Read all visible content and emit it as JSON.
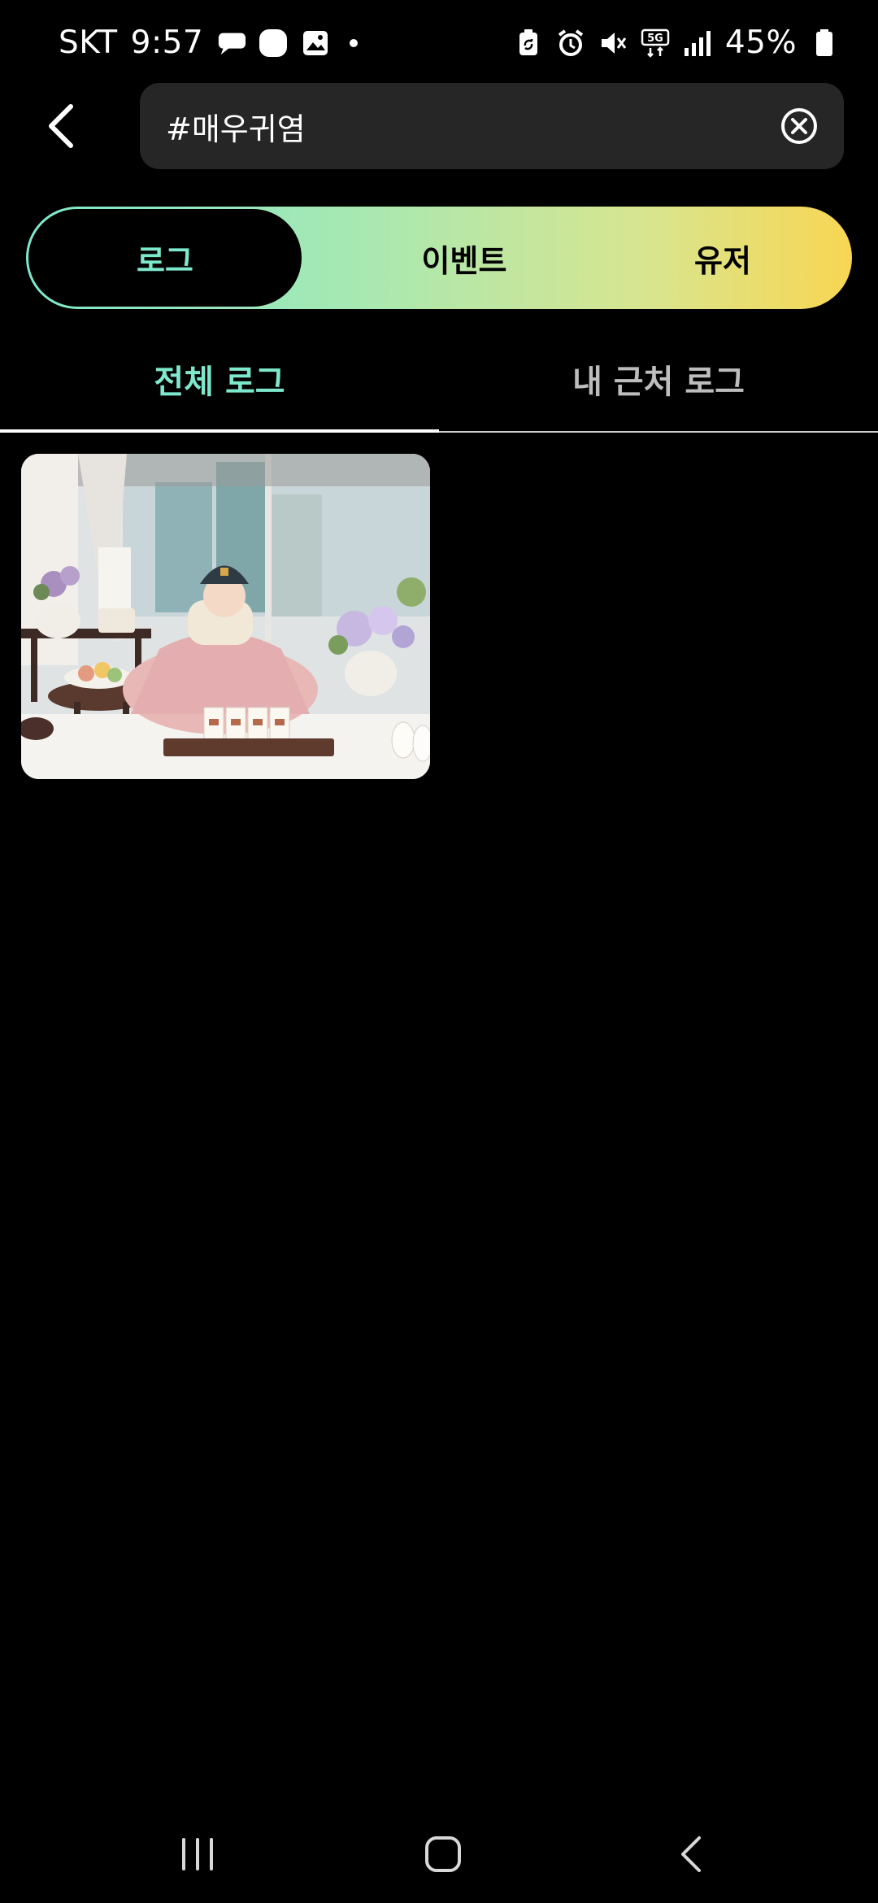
{
  "status_bar": {
    "carrier": "SKT",
    "time": "9:57",
    "battery_percent": "45%",
    "network": "5G",
    "left_icons": [
      "chat-bubble-icon",
      "app-badge-icon",
      "gallery-icon",
      "notification-dot-icon"
    ],
    "right_icons": [
      "battery-saver-icon",
      "alarm-icon",
      "mute-icon",
      "5g-icon",
      "signal-icon",
      "battery-icon"
    ]
  },
  "search": {
    "query": "#매우귀염",
    "back_icon": "chevron-left-icon",
    "clear_icon": "clear-circle-icon"
  },
  "segments": {
    "items": [
      "로그",
      "이벤트",
      "유저"
    ],
    "selected_index": 0,
    "gradient": [
      "#7de8cc",
      "#f8d653"
    ]
  },
  "subtabs": {
    "items": [
      "전체 로그",
      "내 근처 로그"
    ],
    "selected_index": 0,
    "active_color": "#7de8cc"
  },
  "results": {
    "count": 1,
    "thumbnail_description": "baby-in-hanbok-photo"
  },
  "nav_bar": {
    "buttons": [
      "recent-apps-icon",
      "home-icon",
      "back-icon"
    ]
  }
}
